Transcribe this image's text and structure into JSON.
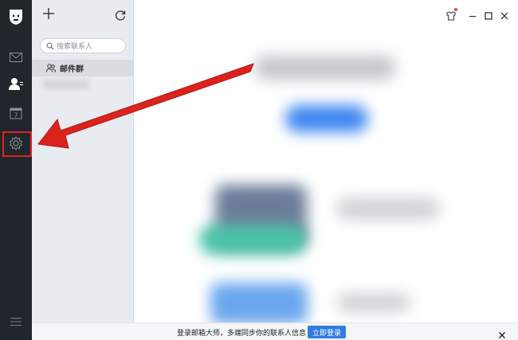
{
  "sidebar": {
    "nav_items": [
      {
        "name": "logo",
        "icon": "app-logo-icon"
      },
      {
        "name": "mail",
        "icon": "mail-icon"
      },
      {
        "name": "contacts",
        "icon": "contacts-icon",
        "active": true
      },
      {
        "name": "calendar",
        "icon": "calendar-icon",
        "date": "7"
      },
      {
        "name": "settings",
        "icon": "gear-icon",
        "highlighted": true
      },
      {
        "name": "menu",
        "icon": "menu-icon"
      }
    ],
    "highlight_color": "#e02121"
  },
  "contacts_pane": {
    "add_icon": "plus-icon",
    "refresh_icon": "refresh-icon",
    "search": {
      "placeholder": "搜索联系人",
      "icon": "search-icon"
    },
    "group_label": "邮件群",
    "group_icon": "group-icon"
  },
  "window_controls": {
    "skin_icon": "skin-icon",
    "minimize_icon": "minimize-icon",
    "maximize_icon": "maximize-icon",
    "close_icon": "close-icon"
  },
  "banner": {
    "message": "登录邮箱大师，多端同步你的联系人信息",
    "login_label": "立即登录",
    "close_icon": "close-icon"
  },
  "colors": {
    "rail": "#21262c",
    "pane": "#e8ebef",
    "accent": "#2f7de1",
    "arrow": "#d9231c"
  }
}
